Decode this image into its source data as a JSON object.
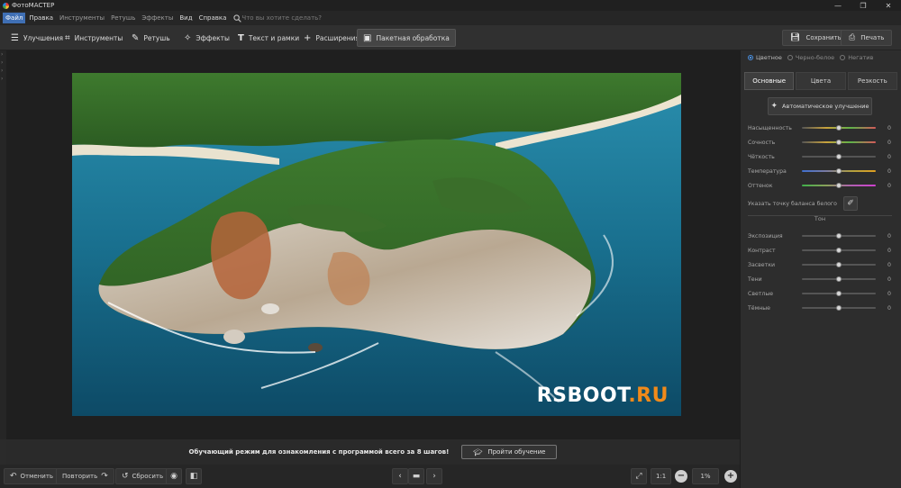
{
  "app": {
    "title": "ФотоМАСТЕР"
  },
  "window_controls": {
    "minimize": "—",
    "maximize": "❐",
    "close": "✕"
  },
  "menu": {
    "items": [
      {
        "label": "Файл",
        "active": true
      },
      {
        "label": "Правка"
      },
      {
        "label": "Инструменты",
        "dim": true
      },
      {
        "label": "Ретушь",
        "dim": true
      },
      {
        "label": "Эффекты",
        "dim": true
      },
      {
        "label": "Вид"
      },
      {
        "label": "Справка"
      }
    ],
    "search_placeholder": "Что вы хотите сделать?"
  },
  "toolbar": {
    "tabs": [
      {
        "label": "Улучшения",
        "icon": "sliders-icon"
      },
      {
        "label": "Инструменты",
        "icon": "crop-icon"
      },
      {
        "label": "Ретушь",
        "icon": "brush-icon"
      },
      {
        "label": "Эффекты",
        "icon": "wand-icon"
      },
      {
        "label": "Текст и рамки",
        "icon": "text-icon"
      },
      {
        "label": "Расширения",
        "icon": "plus-icon"
      },
      {
        "label": "Пакетная обработка",
        "icon": "batch-icon",
        "active": true
      }
    ],
    "save_label": "Сохранить",
    "print_label": "Печать"
  },
  "watermark": {
    "main": "RSBOOT",
    "accent": ".RU"
  },
  "tutorial": {
    "text": "Обучающий режим для ознакомления с программой всего за 8 шагов!",
    "button_label": "Пройти обучение"
  },
  "bottom": {
    "undo_label": "Отменить",
    "redo_label": "Повторить",
    "reset_label": "Сбросить",
    "one_to_one": "1:1",
    "zoom": "1%"
  },
  "panel": {
    "modes": [
      {
        "label": "Цветное",
        "selected": true
      },
      {
        "label": "Черно-белое"
      },
      {
        "label": "Негатив"
      }
    ],
    "tabs": [
      {
        "label": "Основные",
        "active": true
      },
      {
        "label": "Цвета"
      },
      {
        "label": "Резкость"
      }
    ],
    "auto_button": "Автоматическое улучшение",
    "sliders": [
      {
        "label": "Насыщенность",
        "value": "0",
        "level": 0.5,
        "gradient": "linear-gradient(90deg,#555,#c9a23c,#5fb14a,#d65a5a)"
      },
      {
        "label": "Сочность",
        "value": "0",
        "level": 0.5,
        "gradient": "linear-gradient(90deg,#555,#c9a23c,#5fb14a,#d65a5a)"
      },
      {
        "label": "Чёткость",
        "value": "0",
        "level": 0.5,
        "gradient": ""
      },
      {
        "label": "Температура",
        "value": "0",
        "level": 0.5,
        "gradient": "linear-gradient(90deg,#3f6fd0,#7a7aa0,#b0a040,#e0a020)"
      },
      {
        "label": "Оттенок",
        "value": "0",
        "level": 0.5,
        "gradient": "linear-gradient(90deg,#3fb04a,#8aa05a,#b060b0,#d040d0)"
      }
    ],
    "white_balance_label": "Указать точку баланса белого",
    "tone_header": "Тон",
    "tone_sliders": [
      {
        "label": "Экспозиция",
        "value": "0",
        "level": 0.5
      },
      {
        "label": "Контраст",
        "value": "0",
        "level": 0.5
      },
      {
        "label": "Засветки",
        "value": "0",
        "level": 0.5
      },
      {
        "label": "Тени",
        "value": "0",
        "level": 0.5
      },
      {
        "label": "Светлые",
        "value": "0",
        "level": 0.5
      },
      {
        "label": "Тёмные",
        "value": "0",
        "level": 0.5
      }
    ]
  }
}
